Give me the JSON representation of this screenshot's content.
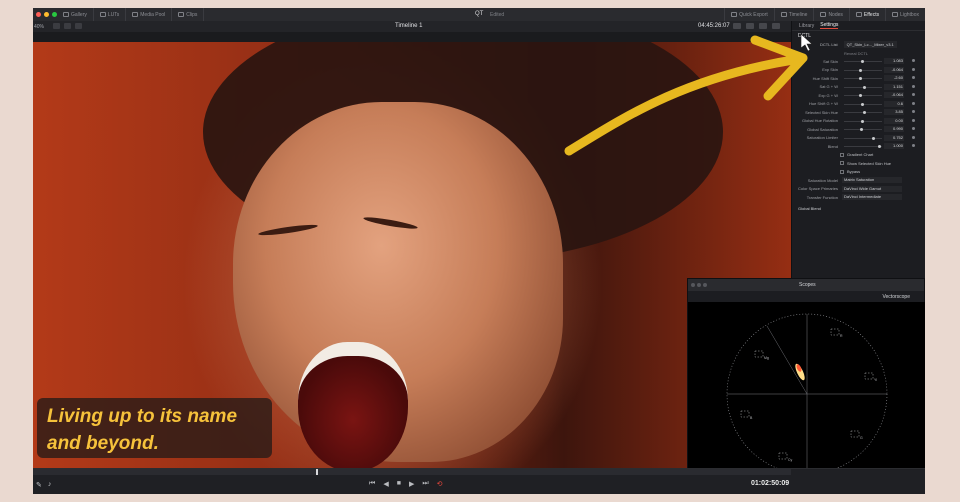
{
  "topbar": {
    "left_items": [
      "Gallery",
      "LUTs",
      "Media Pool",
      "Clips"
    ],
    "title": "QT",
    "subtitle": "Edited",
    "right_items": [
      "Quick Export",
      "Timeline",
      "Nodes",
      "Effects",
      "Lightbox"
    ],
    "active_right": "Effects"
  },
  "viewer_toolbar": {
    "zoom": "40%",
    "timeline_name": "Timeline 1",
    "timecode": "04:45:26:07"
  },
  "caption": {
    "line1": "Living up to its name",
    "line2": "and beyond."
  },
  "panel": {
    "tabs": [
      "Library",
      "Settings"
    ],
    "active_tab": "Settings",
    "section": "DCTL",
    "lut_label": "DCTL List",
    "lut_value": "QT_Skin_Lc..._Mixer_v3.1",
    "reveal_label": "Reveal DCTL",
    "params": [
      {
        "label": "Sat Skin",
        "value": "1.083",
        "pos": 0.5
      },
      {
        "label": "Exp Skin",
        "value": "-0.064",
        "pos": 0.45
      },
      {
        "label": "Hue Shift Skin",
        "value": "-2.60",
        "pos": 0.45
      },
      {
        "label": "Sat G + W",
        "value": "1.151",
        "pos": 0.55
      },
      {
        "label": "Exp G + W",
        "value": "-0.064",
        "pos": 0.45
      },
      {
        "label": "Hue Shift G + W",
        "value": "0.6",
        "pos": 0.5
      },
      {
        "label": "Selected Skin Hue",
        "value": "3.85",
        "pos": 0.55
      },
      {
        "label": "Global Hue Rotation",
        "value": "0.00",
        "pos": 0.5
      },
      {
        "label": "Global Saturation",
        "value": "0.990",
        "pos": 0.48
      },
      {
        "label": "Saturation Limiter",
        "value": "0.752",
        "pos": 0.8
      },
      {
        "label": "Blend",
        "value": "1.000",
        "pos": 0.98
      }
    ],
    "checkboxes": [
      "Gradient Chart",
      "Show Selected Skin Hue",
      "Bypass"
    ],
    "dropdowns": [
      {
        "label": "Saturation Model",
        "value": "Matrix Saturation"
      },
      {
        "label": "Color Space Primaries",
        "value": "DaVinci Wide Gamut"
      },
      {
        "label": "Transfer Function",
        "value": "DaVinci Intermediate"
      }
    ],
    "global_blend": "Global Blend"
  },
  "scopes": {
    "title": "Scopes",
    "mode": "Vectorscope",
    "targets": [
      "R",
      "Mg",
      "B",
      "Cy",
      "G",
      "Yl"
    ]
  },
  "playback": {
    "timecode": "01:02:50:09",
    "playhead": 0.373
  },
  "colors": {
    "caption_text": "#f6c23b",
    "arrow": "#e7b81f",
    "accent_red": "#e04b3c"
  }
}
